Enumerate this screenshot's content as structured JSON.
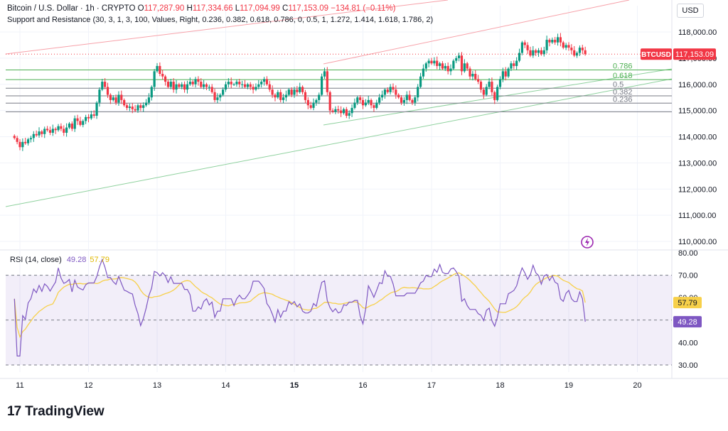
{
  "header": {
    "symbol": "Bitcoin / U.S. Dollar · 1h · CRYPTO",
    "o_label": "O",
    "o_value": "117,287.90",
    "h_label": "H",
    "h_value": "117,334.66",
    "l_label": "L",
    "l_value": "117,094.99",
    "c_label": "C",
    "c_value": "117,153.09",
    "change": "−134.81 (−0.11%)",
    "indicator": "Support and Resistance (30, 3, 1, 3, 100, Values, Right, 0.236, 0.382, 0.618, 0.786, 0, 0.5, 1, 1.272, 1.414, 1.618, 1.786, 2)"
  },
  "currency_button": "USD",
  "brand": {
    "logo": "17",
    "name": "TradingView"
  },
  "colors": {
    "up": "#089981",
    "down": "#f23645",
    "rsi": "#7e57c2",
    "rsi_ma": "#f7d04a",
    "fib": "#4caf50",
    "fib_dark": "#2e7d32",
    "trend_red": "#f7a1a9",
    "trend_green": "#8fd19e"
  },
  "chart_data": [
    {
      "type": "candlestick",
      "symbol": "BTCUSD",
      "last_price_label": "BTCUSD",
      "last_price": "117,153.09",
      "ylim": [
        109800,
        118800
      ],
      "y_ticks": [
        "118,000.00",
        "117,000.00",
        "116,000.00",
        "115,000.00",
        "114,000.00",
        "113,000.00",
        "112,000.00",
        "111,000.00",
        "110,000.00"
      ],
      "x_ticks": [
        "11",
        "12",
        "13",
        "14",
        "15",
        "16",
        "17",
        "18",
        "19",
        "20"
      ],
      "x_range_days": [
        10.9,
        20.4
      ],
      "fib_levels": [
        {
          "label": "0.786",
          "price": 116550
        },
        {
          "label": "0.618",
          "price": 116180
        },
        {
          "label": "0.5",
          "price": 115850
        },
        {
          "label": "0.382",
          "price": 115560
        },
        {
          "label": "0.236",
          "price": 115280
        },
        {
          "label": "",
          "price": 114950
        }
      ],
      "close_series": [
        {
          "t": 10.92,
          "c": 113950
        },
        {
          "t": 10.96,
          "c": 113800
        },
        {
          "t": 11.0,
          "c": 113600
        },
        {
          "t": 11.04,
          "c": 113800
        },
        {
          "t": 11.08,
          "c": 113750
        },
        {
          "t": 11.12,
          "c": 113900
        },
        {
          "t": 11.16,
          "c": 113950
        },
        {
          "t": 11.2,
          "c": 114100
        },
        {
          "t": 11.24,
          "c": 114050
        },
        {
          "t": 11.28,
          "c": 114200
        },
        {
          "t": 11.32,
          "c": 114100
        },
        {
          "t": 11.36,
          "c": 114300
        },
        {
          "t": 11.4,
          "c": 114250
        },
        {
          "t": 11.44,
          "c": 114150
        },
        {
          "t": 11.48,
          "c": 114300
        },
        {
          "t": 11.52,
          "c": 114250
        },
        {
          "t": 11.56,
          "c": 114400
        },
        {
          "t": 11.6,
          "c": 114300
        },
        {
          "t": 11.64,
          "c": 114150
        },
        {
          "t": 11.68,
          "c": 114350
        },
        {
          "t": 11.72,
          "c": 114500
        },
        {
          "t": 11.76,
          "c": 114300
        },
        {
          "t": 11.8,
          "c": 114700
        },
        {
          "t": 11.84,
          "c": 114600
        },
        {
          "t": 11.88,
          "c": 114450
        },
        {
          "t": 11.92,
          "c": 114600
        },
        {
          "t": 11.96,
          "c": 114750
        },
        {
          "t": 12.0,
          "c": 114700
        },
        {
          "t": 12.04,
          "c": 114850
        },
        {
          "t": 12.08,
          "c": 114800
        },
        {
          "t": 12.12,
          "c": 115300
        },
        {
          "t": 12.16,
          "c": 115800
        },
        {
          "t": 12.2,
          "c": 116100
        },
        {
          "t": 12.24,
          "c": 115900
        },
        {
          "t": 12.28,
          "c": 115600
        },
        {
          "t": 12.32,
          "c": 115400
        },
        {
          "t": 12.36,
          "c": 115500
        },
        {
          "t": 12.4,
          "c": 115300
        },
        {
          "t": 12.44,
          "c": 115600
        },
        {
          "t": 12.48,
          "c": 115400
        },
        {
          "t": 12.52,
          "c": 115200
        },
        {
          "t": 12.56,
          "c": 115100
        },
        {
          "t": 12.6,
          "c": 115150
        },
        {
          "t": 12.64,
          "c": 115050
        },
        {
          "t": 12.68,
          "c": 115000
        },
        {
          "t": 12.72,
          "c": 115200
        },
        {
          "t": 12.76,
          "c": 115100
        },
        {
          "t": 12.8,
          "c": 115200
        },
        {
          "t": 12.84,
          "c": 115300
        },
        {
          "t": 12.88,
          "c": 115500
        },
        {
          "t": 12.92,
          "c": 115900
        },
        {
          "t": 12.96,
          "c": 116500
        },
        {
          "t": 13.0,
          "c": 116700
        },
        {
          "t": 13.04,
          "c": 116400
        },
        {
          "t": 13.08,
          "c": 116300
        },
        {
          "t": 13.12,
          "c": 116100
        },
        {
          "t": 13.16,
          "c": 115900
        },
        {
          "t": 13.2,
          "c": 116100
        },
        {
          "t": 13.24,
          "c": 115800
        },
        {
          "t": 13.28,
          "c": 116000
        },
        {
          "t": 13.32,
          "c": 115900
        },
        {
          "t": 13.36,
          "c": 116000
        },
        {
          "t": 13.4,
          "c": 115800
        },
        {
          "t": 13.44,
          "c": 116000
        },
        {
          "t": 13.48,
          "c": 116100
        },
        {
          "t": 13.52,
          "c": 116000
        },
        {
          "t": 13.56,
          "c": 116200
        },
        {
          "t": 13.6,
          "c": 116100
        },
        {
          "t": 13.64,
          "c": 115900
        },
        {
          "t": 13.68,
          "c": 116000
        },
        {
          "t": 13.72,
          "c": 115900
        },
        {
          "t": 13.76,
          "c": 115900
        },
        {
          "t": 13.8,
          "c": 115700
        },
        {
          "t": 13.84,
          "c": 115400
        },
        {
          "t": 13.88,
          "c": 115500
        },
        {
          "t": 13.92,
          "c": 115600
        },
        {
          "t": 13.96,
          "c": 115800
        },
        {
          "t": 14.0,
          "c": 116000
        },
        {
          "t": 14.04,
          "c": 116100
        },
        {
          "t": 14.08,
          "c": 116000
        },
        {
          "t": 14.12,
          "c": 116000
        },
        {
          "t": 14.16,
          "c": 116100
        },
        {
          "t": 14.2,
          "c": 116000
        },
        {
          "t": 14.24,
          "c": 116000
        },
        {
          "t": 14.28,
          "c": 115900
        },
        {
          "t": 14.32,
          "c": 116000
        },
        {
          "t": 14.36,
          "c": 115900
        },
        {
          "t": 14.4,
          "c": 115800
        },
        {
          "t": 14.44,
          "c": 115900
        },
        {
          "t": 14.48,
          "c": 116000
        },
        {
          "t": 14.52,
          "c": 116100
        },
        {
          "t": 14.56,
          "c": 116200
        },
        {
          "t": 14.6,
          "c": 116000
        },
        {
          "t": 14.64,
          "c": 115800
        },
        {
          "t": 14.68,
          "c": 115600
        },
        {
          "t": 14.72,
          "c": 115500
        },
        {
          "t": 14.76,
          "c": 115700
        },
        {
          "t": 14.8,
          "c": 115400
        },
        {
          "t": 14.84,
          "c": 115500
        },
        {
          "t": 14.88,
          "c": 115600
        },
        {
          "t": 14.92,
          "c": 115800
        },
        {
          "t": 14.96,
          "c": 115600
        },
        {
          "t": 15.0,
          "c": 115800
        },
        {
          "t": 15.04,
          "c": 115700
        },
        {
          "t": 15.08,
          "c": 115900
        },
        {
          "t": 15.12,
          "c": 115700
        },
        {
          "t": 15.16,
          "c": 115400
        },
        {
          "t": 15.2,
          "c": 115200
        },
        {
          "t": 15.24,
          "c": 115100
        },
        {
          "t": 15.28,
          "c": 115300
        },
        {
          "t": 15.32,
          "c": 115400
        },
        {
          "t": 15.36,
          "c": 115600
        },
        {
          "t": 15.4,
          "c": 116300
        },
        {
          "t": 15.44,
          "c": 116500
        },
        {
          "t": 15.48,
          "c": 115700
        },
        {
          "t": 15.52,
          "c": 115000
        },
        {
          "t": 15.56,
          "c": 114950
        },
        {
          "t": 15.6,
          "c": 115050
        },
        {
          "t": 15.64,
          "c": 115000
        },
        {
          "t": 15.68,
          "c": 114900
        },
        {
          "t": 15.72,
          "c": 115050
        },
        {
          "t": 15.76,
          "c": 114800
        },
        {
          "t": 15.8,
          "c": 114900
        },
        {
          "t": 15.84,
          "c": 115100
        },
        {
          "t": 15.88,
          "c": 115300
        },
        {
          "t": 15.92,
          "c": 115500
        },
        {
          "t": 15.96,
          "c": 115400
        },
        {
          "t": 16.0,
          "c": 115200
        },
        {
          "t": 16.04,
          "c": 115300
        },
        {
          "t": 16.08,
          "c": 115400
        },
        {
          "t": 16.12,
          "c": 115200
        },
        {
          "t": 16.16,
          "c": 115100
        },
        {
          "t": 16.2,
          "c": 115300
        },
        {
          "t": 16.24,
          "c": 115500
        },
        {
          "t": 16.28,
          "c": 115600
        },
        {
          "t": 16.32,
          "c": 115800
        },
        {
          "t": 16.36,
          "c": 115700
        },
        {
          "t": 16.4,
          "c": 115900
        },
        {
          "t": 16.44,
          "c": 115800
        },
        {
          "t": 16.48,
          "c": 115600
        },
        {
          "t": 16.52,
          "c": 115500
        },
        {
          "t": 16.56,
          "c": 115300
        },
        {
          "t": 16.6,
          "c": 115400
        },
        {
          "t": 16.64,
          "c": 115600
        },
        {
          "t": 16.68,
          "c": 115400
        },
        {
          "t": 16.72,
          "c": 115300
        },
        {
          "t": 16.76,
          "c": 115500
        },
        {
          "t": 16.8,
          "c": 115900
        },
        {
          "t": 16.84,
          "c": 116300
        },
        {
          "t": 16.88,
          "c": 116600
        },
        {
          "t": 16.92,
          "c": 116800
        },
        {
          "t": 16.96,
          "c": 116900
        },
        {
          "t": 17.0,
          "c": 116800
        },
        {
          "t": 17.04,
          "c": 116900
        },
        {
          "t": 17.08,
          "c": 116700
        },
        {
          "t": 17.12,
          "c": 116800
        },
        {
          "t": 17.16,
          "c": 116600
        },
        {
          "t": 17.2,
          "c": 116700
        },
        {
          "t": 17.24,
          "c": 116500
        },
        {
          "t": 17.28,
          "c": 116600
        },
        {
          "t": 17.32,
          "c": 116900
        },
        {
          "t": 17.36,
          "c": 117000
        },
        {
          "t": 17.4,
          "c": 117100
        },
        {
          "t": 17.44,
          "c": 116500
        },
        {
          "t": 17.48,
          "c": 116800
        },
        {
          "t": 17.52,
          "c": 116600
        },
        {
          "t": 17.56,
          "c": 116300
        },
        {
          "t": 17.6,
          "c": 116400
        },
        {
          "t": 17.64,
          "c": 116200
        },
        {
          "t": 17.68,
          "c": 116100
        },
        {
          "t": 17.72,
          "c": 115800
        },
        {
          "t": 17.76,
          "c": 115600
        },
        {
          "t": 17.8,
          "c": 115900
        },
        {
          "t": 17.84,
          "c": 116100
        },
        {
          "t": 17.88,
          "c": 115700
        },
        {
          "t": 17.92,
          "c": 115400
        },
        {
          "t": 17.96,
          "c": 115900
        },
        {
          "t": 18.0,
          "c": 116200
        },
        {
          "t": 18.04,
          "c": 116500
        },
        {
          "t": 18.08,
          "c": 116300
        },
        {
          "t": 18.12,
          "c": 116600
        },
        {
          "t": 18.16,
          "c": 116800
        },
        {
          "t": 18.2,
          "c": 116700
        },
        {
          "t": 18.24,
          "c": 116900
        },
        {
          "t": 18.28,
          "c": 117200
        },
        {
          "t": 18.32,
          "c": 117600
        },
        {
          "t": 18.36,
          "c": 117500
        },
        {
          "t": 18.4,
          "c": 117300
        },
        {
          "t": 18.44,
          "c": 117100
        },
        {
          "t": 18.48,
          "c": 117300
        },
        {
          "t": 18.52,
          "c": 117200
        },
        {
          "t": 18.56,
          "c": 117300
        },
        {
          "t": 18.6,
          "c": 117150
        },
        {
          "t": 18.64,
          "c": 117300
        },
        {
          "t": 18.68,
          "c": 117700
        },
        {
          "t": 18.72,
          "c": 117600
        },
        {
          "t": 18.76,
          "c": 117700
        },
        {
          "t": 18.8,
          "c": 117600
        },
        {
          "t": 18.84,
          "c": 117800
        },
        {
          "t": 18.88,
          "c": 117600
        },
        {
          "t": 18.92,
          "c": 117400
        },
        {
          "t": 18.96,
          "c": 117500
        },
        {
          "t": 19.0,
          "c": 117400
        },
        {
          "t": 19.04,
          "c": 117300
        },
        {
          "t": 19.08,
          "c": 117100
        },
        {
          "t": 19.12,
          "c": 117200
        },
        {
          "t": 19.16,
          "c": 117400
        },
        {
          "t": 19.2,
          "c": 117300
        },
        {
          "t": 19.24,
          "c": 117153
        }
      ]
    },
    {
      "type": "line",
      "title": "RSI (14, close)",
      "series": [
        {
          "name": "RSI",
          "value_label": "49.28"
        },
        {
          "name": "RSI MA",
          "value_label": "57.79"
        }
      ],
      "ylim": [
        28,
        82
      ],
      "y_ticks": [
        "80.00",
        "70.00",
        "60.00",
        "40.00",
        "30.00"
      ],
      "band": [
        30,
        70
      ],
      "mid": 50
    }
  ]
}
